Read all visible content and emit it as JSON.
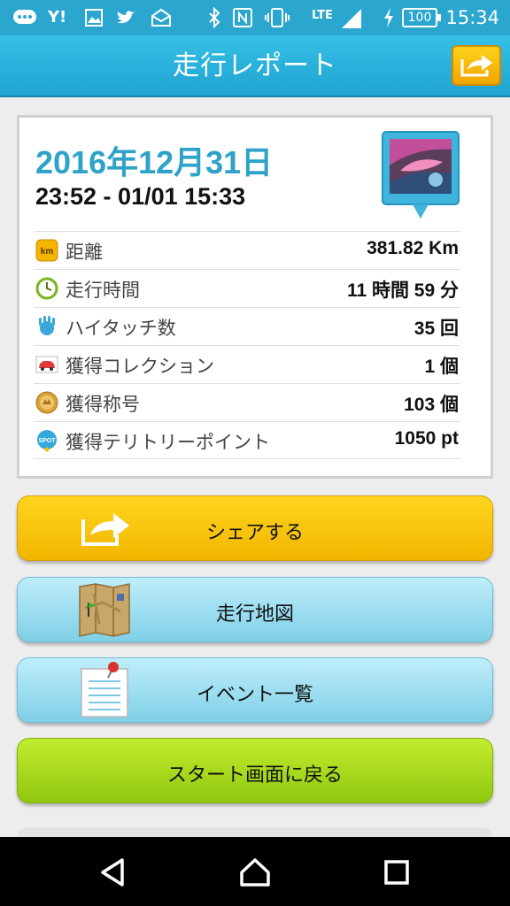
{
  "status_bar": {
    "time": "15:34",
    "battery": "100",
    "network": "LTE",
    "icons": [
      "messages-icon",
      "yahoo-icon",
      "image-icon",
      "twitter-icon",
      "mail-icon",
      "bluetooth-icon",
      "nfc-icon",
      "vibrate-icon",
      "signal-icon",
      "charging-icon"
    ]
  },
  "header": {
    "title": "走行レポート",
    "share_icon": "share-arrow-icon"
  },
  "report": {
    "date": "2016年12月31日",
    "time_range": "23:52 - 01/01 15:33",
    "photo_icon": "photo-pin-icon",
    "stats": [
      {
        "icon": "km-icon",
        "label": "距離",
        "value": "381.82 Km"
      },
      {
        "icon": "clock-icon",
        "label": "走行時間",
        "value": "11 時間 59 分"
      },
      {
        "icon": "hi-touch-icon",
        "label": "ハイタッチ数",
        "value": "35 回"
      },
      {
        "icon": "car-icon",
        "label": "獲得コレクション",
        "value": "1 個"
      },
      {
        "icon": "title-medal-icon",
        "label": "獲得称号",
        "value": "103 個"
      },
      {
        "icon": "spot-icon",
        "label": "獲得テリトリーポイント",
        "value": "1050 pt"
      }
    ]
  },
  "buttons": {
    "share": "シェアする",
    "map": "走行地図",
    "events": "イベント一覧",
    "back_to_start": "スタート画面に戻る"
  },
  "colors": {
    "accent": "#2ba6cf",
    "date_text": "#2ea2c8",
    "share_button": "#f7c20a",
    "map_button": "#9fdef0",
    "start_button": "#a6d81a"
  }
}
